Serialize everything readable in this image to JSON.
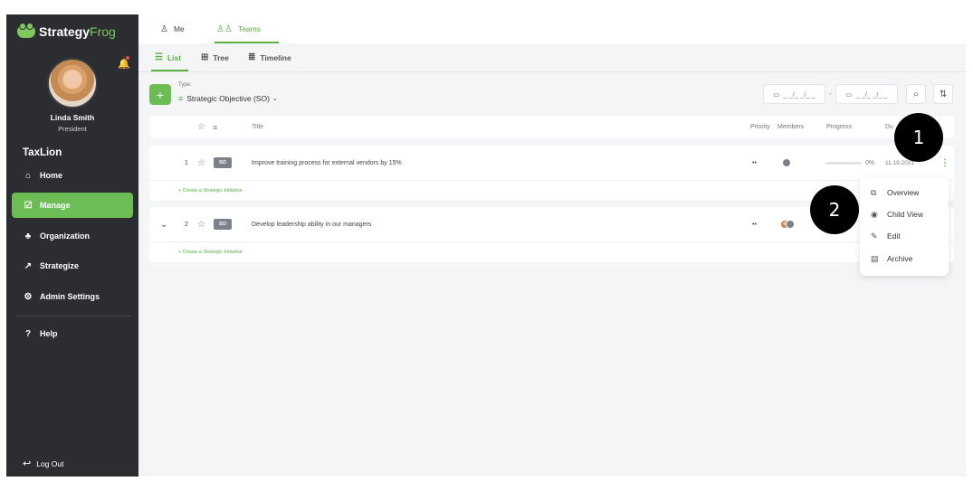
{
  "app": {
    "logo_strategy": "Strategy",
    "logo_frog": "Frog"
  },
  "user": {
    "name": "Linda Smith",
    "role": "President",
    "org": "TaxLion"
  },
  "sidebar": {
    "items": [
      {
        "label": "Home",
        "icon": "home-icon"
      },
      {
        "label": "Manage",
        "icon": "checkbox-icon",
        "active": true
      },
      {
        "label": "Organization",
        "icon": "org-chart-icon"
      },
      {
        "label": "Strategize",
        "icon": "chart-icon"
      },
      {
        "label": "Admin Settings",
        "icon": "gear-icon"
      },
      {
        "label": "Help",
        "icon": "help-icon"
      }
    ],
    "logout": "Log Out"
  },
  "top_tabs": [
    {
      "label": "Me",
      "icon": "person-icon"
    },
    {
      "label": "Teams",
      "icon": "people-icon",
      "active": true
    }
  ],
  "sub_tabs": [
    {
      "label": "List",
      "icon": "list-icon",
      "active": true
    },
    {
      "label": "Tree",
      "icon": "tree-icon"
    },
    {
      "label": "Timeline",
      "icon": "timeline-icon"
    }
  ],
  "filter": {
    "type_label": "Type:",
    "type_value": "Strategic Objective (SO)",
    "date_from": "_ _/_ _/_ _",
    "date_to": "_ _/_ _/_ _",
    "date_separator": "-"
  },
  "table": {
    "headers": {
      "title": "Title",
      "priority": "Priority",
      "members": "Members",
      "progress": "Progress",
      "due": "Du"
    },
    "rows": [
      {
        "number": "1",
        "badge": "SO",
        "title": "Improve training process for external vendors by 15%",
        "priority": "••",
        "progress": "0%",
        "due": "11.19.2021",
        "create_link": "+ Create a Strategic Initiative"
      },
      {
        "number": "2",
        "badge": "SO",
        "title": "Develop leadership ability in our managers",
        "priority": "••",
        "create_link": "+ Create a Strategic Initiative"
      }
    ]
  },
  "menu": {
    "items": [
      {
        "label": "Overview",
        "icon": "external-link-icon"
      },
      {
        "label": "Child View",
        "icon": "eye-icon"
      },
      {
        "label": "Edit",
        "icon": "pencil-icon"
      },
      {
        "label": "Archive",
        "icon": "archive-icon"
      }
    ]
  },
  "callouts": {
    "one": "1",
    "two": "2"
  },
  "colors": {
    "accent": "#6dbd56",
    "sidebar_bg": "#2b2d31",
    "badge": "#7c8088"
  }
}
